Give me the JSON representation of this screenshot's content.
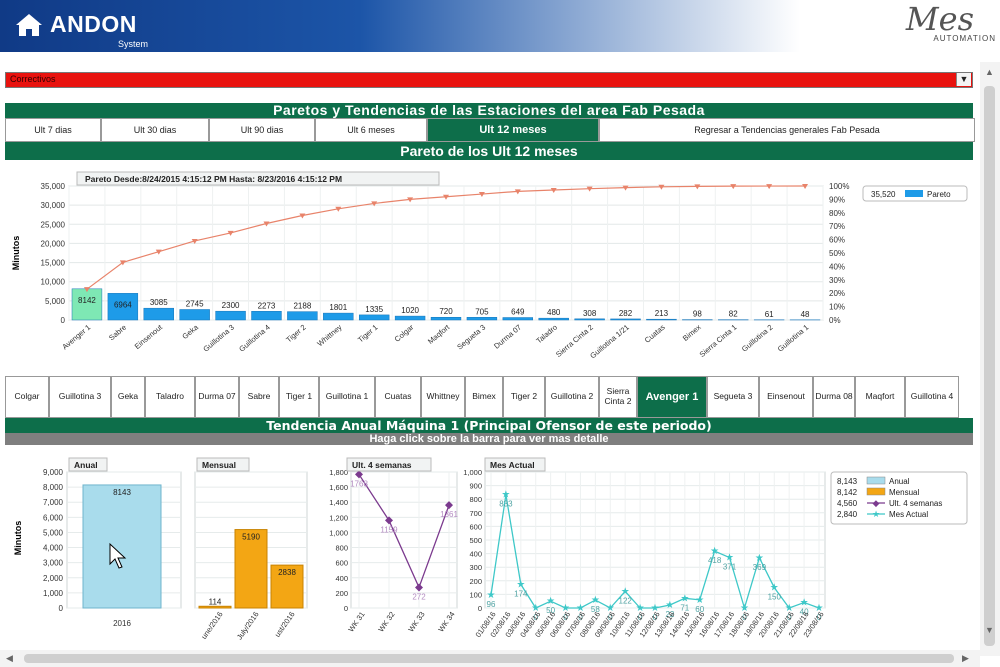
{
  "header": {
    "brand": "ANDON",
    "brand_sub": "System",
    "vendor": "Mes",
    "vendor_sub": "AUTOMATION"
  },
  "selector": {
    "value": "Correctivos"
  },
  "main_title": "Paretos y Tendencias de las Estaciones del area Fab Pesada",
  "tabs": [
    {
      "label": "Ult 7 dias"
    },
    {
      "label": "Ult 30 dias"
    },
    {
      "label": "Ult 90 dias"
    },
    {
      "label": "Ult 6 meses"
    },
    {
      "label": "Ult 12 meses"
    },
    {
      "label": "Regresar a Tendencias generales Fab Pesada"
    }
  ],
  "pareto_title": "Pareto de los Ult 12 meses",
  "stations": [
    {
      "label": "Colgar"
    },
    {
      "label": "Guillotina 3"
    },
    {
      "label": "Geka"
    },
    {
      "label": "Taladro"
    },
    {
      "label": "Durma 07"
    },
    {
      "label": "Sabre"
    },
    {
      "label": "Tiger 1"
    },
    {
      "label": "Guillotina 1"
    },
    {
      "label": "Cuatas"
    },
    {
      "label": "Whittney"
    },
    {
      "label": "Bimex"
    },
    {
      "label": "Tiger 2"
    },
    {
      "label": "Guillotina 2"
    },
    {
      "label": "Sierra Cinta 2"
    },
    {
      "label": "Avenger 1"
    },
    {
      "label": "Segueta 3"
    },
    {
      "label": "Einsenout"
    },
    {
      "label": "Durma 08"
    },
    {
      "label": "Maqfort"
    },
    {
      "label": "Guillotina 4"
    }
  ],
  "trend_title": "Tendencia Anual Máquina 1 (Principal Ofensor de este periodo)",
  "trend_subtitle": "Haga click sobre la barra para ver mas detalle",
  "colors": {
    "green": "#0d6e4a",
    "pareto_bar": "#1e9be8",
    "pareto_first": "#7ee8b4",
    "pareto_line": "#e8836a",
    "anual": "#a9dcec",
    "mensual": "#f3a614",
    "semanas": "#7b3a8e",
    "mes_actual": "#3ec8c8"
  },
  "chart_data": [
    {
      "type": "bar",
      "title": "Pareto Desde:8/24/2015 4:15:12 PM Hasta: 8/23/2016 4:15:12 PM",
      "ylabel": "Minutos",
      "ylim": [
        0,
        35000
      ],
      "yticks": [
        "0",
        "5,000",
        "10,000",
        "15,000",
        "20,000",
        "25,000",
        "30,000",
        "35,000"
      ],
      "y2ticks": [
        "0%",
        "10%",
        "20%",
        "30%",
        "40%",
        "50%",
        "60%",
        "70%",
        "80%",
        "90%",
        "100%"
      ],
      "categories": [
        "Avenger 1",
        "Sabre",
        "Einsenout",
        "Geka",
        "Guillotina 3",
        "Guillotina 4",
        "Tiger 2",
        "Whittney",
        "Tiger 1",
        "Colgar",
        "Maqfort",
        "Segueta 3",
        "Durma 07",
        "Taladro",
        "Sierra Cinta 2",
        "Guillotina 1/21",
        "Cuatas",
        "Bimex",
        "Sierra Cinta 1",
        "Guillotina 2",
        "Guillotina 1"
      ],
      "values": [
        8142,
        6964,
        3085,
        2745,
        2300,
        2273,
        2188,
        1801,
        1335,
        1020,
        720,
        705,
        649,
        480,
        308,
        282,
        213,
        98,
        82,
        61,
        48
      ],
      "value_labels": [
        "8142",
        "6964",
        "3085",
        "2745",
        "2300",
        "2273",
        "2188",
        "1801",
        "1335",
        "1020",
        "720",
        "705",
        "649",
        "480",
        "308",
        "282",
        "213",
        "98",
        "82",
        "61",
        "48"
      ],
      "cumulative_pct": [
        23,
        43,
        51,
        59,
        65,
        72,
        78,
        83,
        87,
        90,
        92,
        94,
        96,
        97,
        98,
        98.8,
        99.4,
        99.7,
        99.9,
        99.95,
        100
      ],
      "legend": [
        {
          "name": "35,520",
          "label": "Pareto"
        }
      ]
    },
    {
      "type": "bar",
      "title": "Anual",
      "ylabel": "Minutos",
      "ylim": [
        0,
        9000
      ],
      "yticks": [
        "0",
        "1,000",
        "2,000",
        "3,000",
        "4,000",
        "5,000",
        "6,000",
        "7,000",
        "8,000",
        "9,000"
      ],
      "categories": [
        "2016"
      ],
      "values": [
        8143
      ]
    },
    {
      "type": "bar",
      "title": "Mensual",
      "categories": [
        "June/2016",
        "July/2016",
        "August/2016"
      ],
      "category_labels": [
        "une/2016",
        "July/2016",
        "ust/2016"
      ],
      "values": [
        114,
        5190,
        2838
      ]
    },
    {
      "type": "line",
      "title": "Ult. 4 semanas",
      "ylim": [
        0,
        1800
      ],
      "yticks": [
        "0",
        "200",
        "400",
        "600",
        "800",
        "1,000",
        "1,200",
        "1,400",
        "1,600",
        "1,800"
      ],
      "categories": [
        "WK 31",
        "WK 32",
        "WK 33",
        "WK 34"
      ],
      "values": [
        1768,
        1159,
        272,
        1361
      ],
      "value_labels": [
        "1768",
        "1159",
        "272",
        "1361"
      ]
    },
    {
      "type": "line",
      "title": "Mes Actual",
      "ylim": [
        0,
        1000
      ],
      "yticks": [
        "0",
        "100",
        "200",
        "300",
        "400",
        "500",
        "600",
        "700",
        "800",
        "900",
        "1,000"
      ],
      "categories": [
        "01/08/16",
        "02/08/16",
        "03/08/16",
        "04/08/16",
        "05/08/16",
        "06/08/16",
        "07/08/16",
        "08/08/16",
        "09/08/16",
        "10/08/16",
        "11/08/16",
        "12/08/16",
        "13/08/16",
        "14/08/16",
        "15/08/16",
        "16/08/16",
        "17/08/16",
        "18/08/16",
        "19/08/16",
        "20/08/16",
        "21/08/16",
        "22/08/16",
        "23/08/16"
      ],
      "values": [
        96,
        833,
        174,
        0,
        50,
        0,
        0,
        58,
        0,
        122,
        0,
        0,
        22,
        71,
        60,
        418,
        371,
        0,
        369,
        150,
        0,
        40,
        0
      ],
      "value_labels": [
        "96",
        "833",
        "174",
        "0",
        "50",
        "0",
        "0",
        "58",
        "0",
        "122",
        "0",
        "0",
        "22",
        "71",
        "60",
        "418",
        "371",
        "0",
        "369",
        "150",
        "0",
        "40",
        "0"
      ]
    }
  ],
  "legend_bottom": [
    {
      "value": "8,143",
      "label": "Anual"
    },
    {
      "value": "8,142",
      "label": "Mensual"
    },
    {
      "value": "4,560",
      "label": "Ult. 4 semanas"
    },
    {
      "value": "2,840",
      "label": "Mes Actual"
    }
  ]
}
